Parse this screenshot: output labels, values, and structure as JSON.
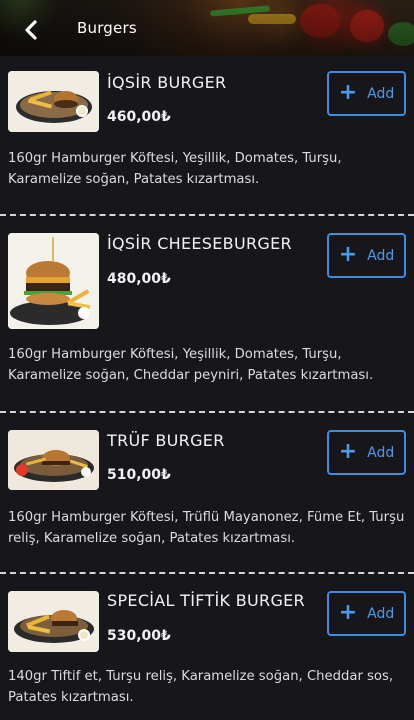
{
  "header": {
    "title": "Burgers",
    "back_icon": "chevron-left-icon"
  },
  "items": [
    {
      "name": "İQSİR BURGER",
      "price": "460,00₺",
      "add_label": "Add",
      "description": "160gr Hamburger Köftesi, Yeşillik, Domates, Turşu, Karamelize soğan, Patates kızartması."
    },
    {
      "name": "İQSİR CHEESEBURGER",
      "price": "480,00₺",
      "add_label": "Add",
      "description": "160gr Hamburger Köftesi, Yeşillik, Domates, Turşu, Karamelize soğan, Cheddar peyniri, Patates kızartması."
    },
    {
      "name": "TRÜF BURGER",
      "price": "510,00₺",
      "add_label": "Add",
      "description": "160gr Hamburger Köftesi, Trüflü Mayanonez, Füme Et, Turşu reliş, Karamelize soğan, Patates kızartması."
    },
    {
      "name": "SPECİAL TİFTİK BURGER",
      "price": "530,00₺",
      "add_label": "Add",
      "description": "140gr Tiftif et, Turşu reliş, Karamelize soğan, Cheddar sos, Patates kızartması."
    }
  ],
  "colors": {
    "accent": "#3d8ee0",
    "background": "#17161b",
    "divider": "#d6d6d6"
  }
}
